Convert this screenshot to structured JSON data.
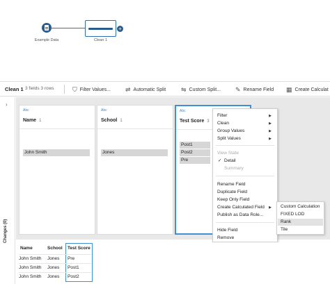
{
  "flow": {
    "input_label": "Example Data",
    "clean_label": "Clean 1",
    "add_symbol": "+"
  },
  "toolbar": {
    "step_name": "Clean 1",
    "counts": "3 fields  3 rows",
    "buttons": [
      {
        "label": "Filter Values...",
        "icon": "filter-icon"
      },
      {
        "label": "Automatic Split",
        "icon": "split-icon"
      },
      {
        "label": "Custom Split...",
        "icon": "custom-split-icon"
      },
      {
        "label": "Rename Field",
        "icon": "rename-icon"
      },
      {
        "label": "Create Calculat",
        "icon": "calc-icon"
      }
    ]
  },
  "side": {
    "toggle": "›",
    "changes_label": "Changes (0)"
  },
  "profile": {
    "cards": [
      {
        "type": "Abc",
        "name": "Name",
        "count": "1",
        "values": [
          "John Smith"
        ]
      },
      {
        "type": "Abc",
        "name": "School",
        "count": "1",
        "values": [
          "Jones"
        ]
      },
      {
        "type": "Abc",
        "name": "Test Score",
        "count": "3",
        "values": [
          "Post1",
          "Post2",
          "Pre"
        ]
      }
    ]
  },
  "menu": {
    "items": [
      {
        "label": "Filter",
        "submenu": true
      },
      {
        "label": "Clean",
        "submenu": true
      },
      {
        "label": "Group Values",
        "submenu": true
      },
      {
        "label": "Split Values",
        "submenu": true
      },
      {
        "label": "View State",
        "disabled": true
      },
      {
        "label": "Detail",
        "checked": true
      },
      {
        "label": "Summary",
        "disabled": true
      },
      {
        "label": "Rename Field"
      },
      {
        "label": "Duplicate Field"
      },
      {
        "label": "Keep Only Field"
      },
      {
        "label": "Create Calculated Field",
        "submenu": true
      },
      {
        "label": "Publish as Data Role..."
      },
      {
        "label": "Hide Field"
      },
      {
        "label": "Remove"
      }
    ],
    "check_mark": "✓",
    "arrow": "▶",
    "submenu": [
      "Custom Calculation",
      "FIXED LOD",
      "Rank",
      "Tile"
    ],
    "highlighted": "Rank"
  },
  "grid": {
    "headers": [
      "Name",
      "School",
      "Test Score"
    ],
    "rows": [
      [
        "John Smith",
        "Jones",
        "Pre"
      ],
      [
        "John Smith",
        "Jones",
        "Post1"
      ],
      [
        "John Smith",
        "Jones",
        "Post2"
      ]
    ]
  }
}
